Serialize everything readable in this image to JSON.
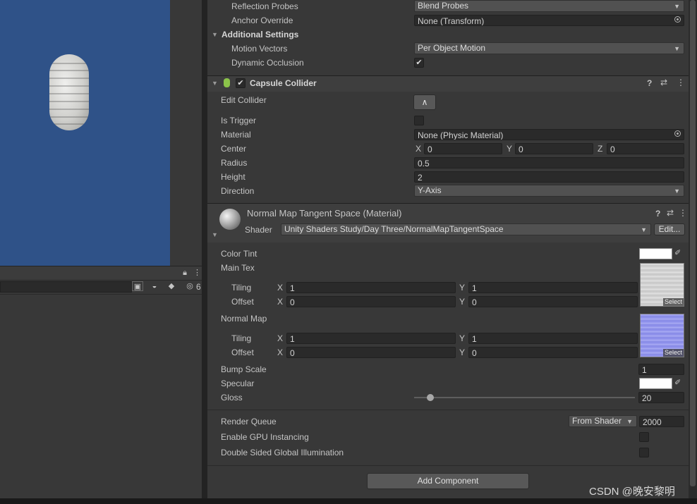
{
  "hierarchy": {
    "lock_icon": "lock-icon",
    "menu_icon": "kebab-menu-icon",
    "hidden_count": "6"
  },
  "inspector": {
    "reflection_probes": {
      "label": "Reflection Probes",
      "value": "Blend Probes"
    },
    "anchor_override": {
      "label": "Anchor Override",
      "value": "None (Transform)"
    },
    "additional_settings": "Additional Settings",
    "motion_vectors": {
      "label": "Motion Vectors",
      "value": "Per Object Motion"
    },
    "dynamic_occlusion": {
      "label": "Dynamic Occlusion",
      "checked": true
    },
    "capsule_collider": {
      "title": "Capsule Collider",
      "enabled": true,
      "edit_collider": "Edit Collider",
      "is_trigger": {
        "label": "Is Trigger",
        "checked": false
      },
      "material": {
        "label": "Material",
        "value": "None (Physic Material)"
      },
      "center": {
        "label": "Center",
        "x": "0",
        "y": "0",
        "z": "0"
      },
      "radius": {
        "label": "Radius",
        "value": "0.5"
      },
      "height": {
        "label": "Height",
        "value": "2"
      },
      "direction": {
        "label": "Direction",
        "value": "Y-Axis"
      }
    },
    "material": {
      "title": "Normal Map Tangent Space (Material)",
      "shader_label": "Shader",
      "shader_value": "Unity Shaders Study/Day Three/NormalMapTangentSpace",
      "edit_button": "Edit...",
      "color_tint": "Color Tint",
      "main_tex": {
        "label": "Main Tex",
        "tiling_label": "Tiling",
        "offset_label": "Offset",
        "tiling_x": "1",
        "tiling_y": "1",
        "offset_x": "0",
        "offset_y": "0",
        "select": "Select"
      },
      "normal_map": {
        "label": "Normal Map",
        "tiling_label": "Tiling",
        "offset_label": "Offset",
        "tiling_x": "1",
        "tiling_y": "1",
        "offset_x": "0",
        "offset_y": "0",
        "select": "Select"
      },
      "bump_scale": {
        "label": "Bump Scale",
        "value": "1"
      },
      "specular": "Specular",
      "gloss": {
        "label": "Gloss",
        "value": "20",
        "slider_fraction": 0.075
      },
      "render_queue": {
        "label": "Render Queue",
        "mode": "From Shader",
        "value": "2000"
      },
      "gpu_instancing": {
        "label": "Enable GPU Instancing",
        "checked": false
      },
      "double_sided_gi": {
        "label": "Double Sided Global Illumination",
        "checked": false
      }
    },
    "add_component": "Add Component"
  },
  "axes": {
    "x": "X",
    "y": "Y",
    "z": "Z"
  },
  "colors": {
    "scene_bg": "#2f5288",
    "panel_bg": "#383838",
    "field_bg": "#2a2a2a",
    "collider_icon": "#8bc34a",
    "normal_map_tint": "#9a9cf0"
  },
  "watermark": "CSDN @晚安黎明"
}
